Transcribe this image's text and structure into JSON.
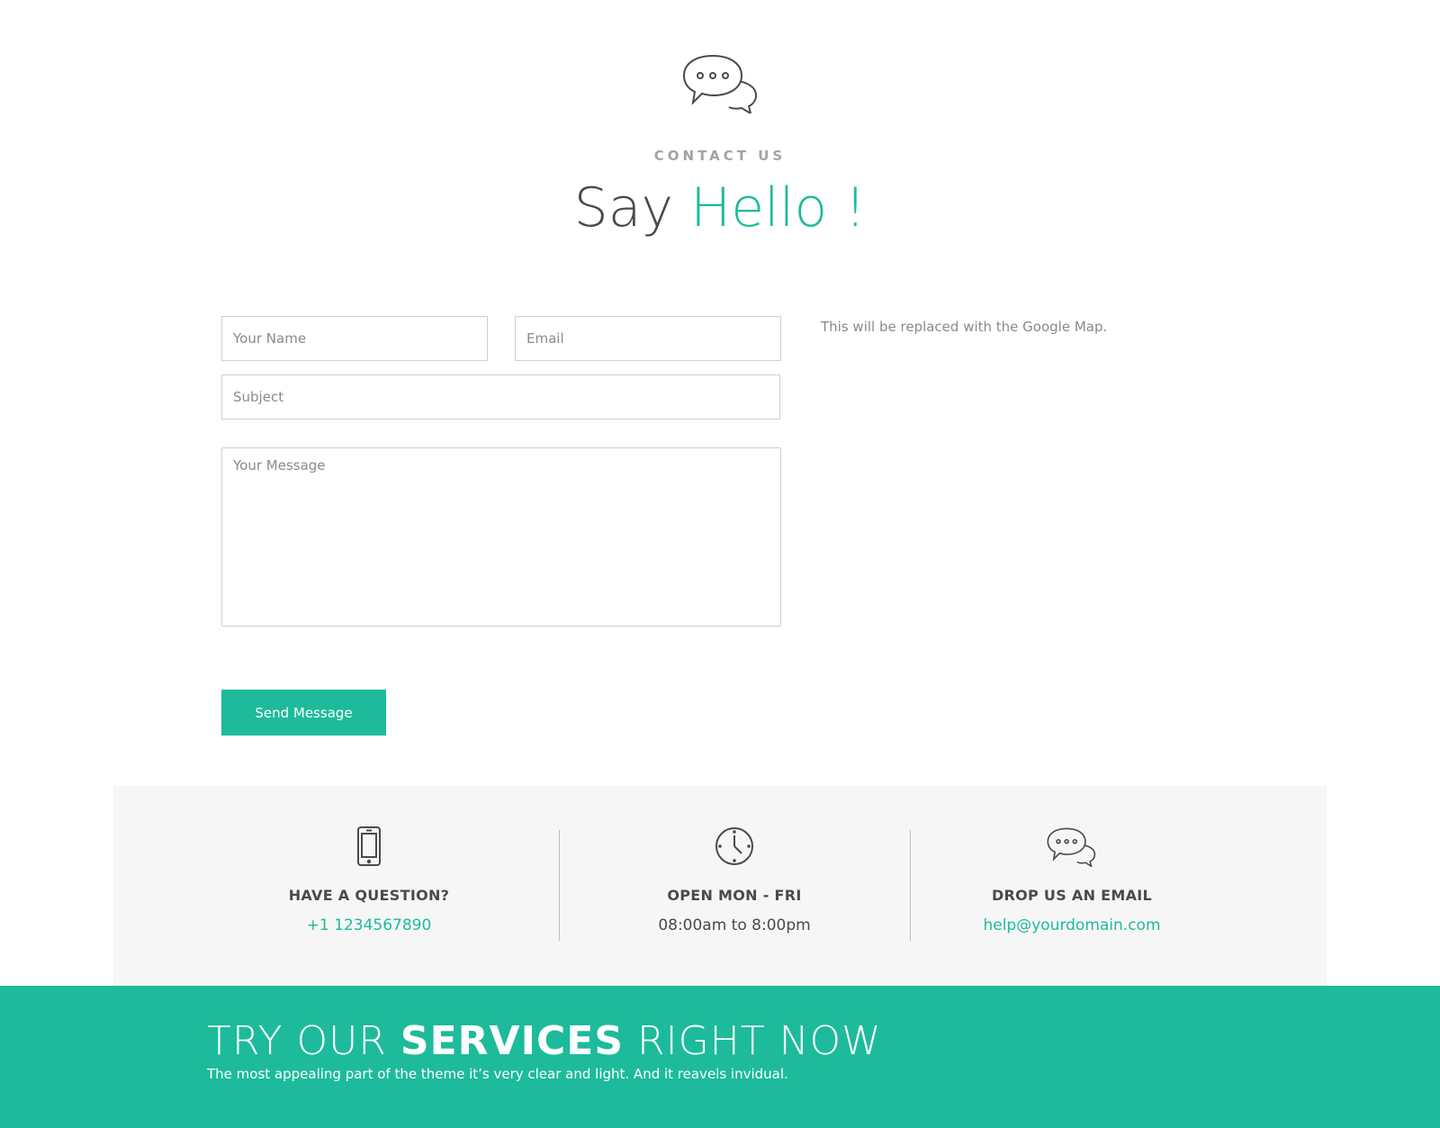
{
  "contact": {
    "eyebrow": "CONTACT US",
    "headline_plain": "Say",
    "headline_accent": "Hello !",
    "icon": "chat-bubbles-icon"
  },
  "form": {
    "name_placeholder": "Your Name",
    "email_placeholder": "Email",
    "subject_placeholder": "Subject",
    "message_placeholder": "Your Message",
    "send_label": "Send Message"
  },
  "map": {
    "note": "This will be replaced with the Google Map."
  },
  "info": [
    {
      "icon": "smartphone-icon",
      "title": "HAVE A QUESTION?",
      "value": "+1 1234567890"
    },
    {
      "icon": "clock-icon",
      "title": "OPEN MON - FRI",
      "value": "08:00am to 8:00pm"
    },
    {
      "icon": "chat-bubbles-icon",
      "title": "DROP US AN EMAIL",
      "value": "help@yourdomain.com"
    }
  ],
  "cta": {
    "title_pre": "TRY OUR",
    "title_bold": "SERVICES",
    "title_post": "RIGHT NOW",
    "subtitle": "The most appealing part of the theme it’s very clear and light. And it reavels invidual."
  },
  "colors": {
    "accent": "#1dbb9b",
    "strip_bg": "#f6f6f6",
    "text_dark": "#4a4a4a"
  }
}
